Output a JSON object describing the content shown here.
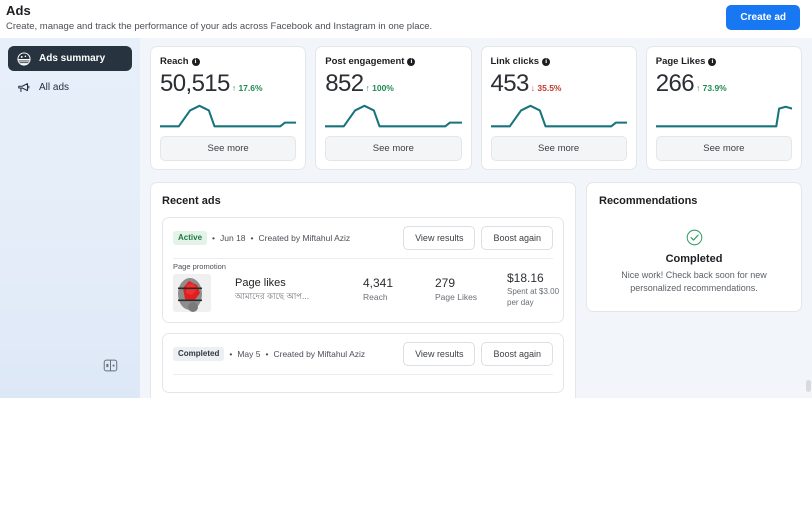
{
  "header": {
    "title": "Ads",
    "subtitle": "Create, manage and track the performance of your ads across Facebook and Instagram in one place.",
    "create_ad_label": "Create ad"
  },
  "sidebar": {
    "items": [
      {
        "label": "Ads summary",
        "icon": "ads-summary-icon",
        "active": true
      },
      {
        "label": "All ads",
        "icon": "megaphone-icon",
        "active": false
      }
    ],
    "toggle_icon": "sidebar-toggle-icon"
  },
  "stats": {
    "see_more_label": "See more",
    "cards": [
      {
        "label": "Reach",
        "value": "50,515",
        "delta": "17.6%",
        "direction": "up",
        "arrow": "↑"
      },
      {
        "label": "Post engagement",
        "value": "852",
        "delta": "100%",
        "direction": "up",
        "arrow": "↑"
      },
      {
        "label": "Link clicks",
        "value": "453",
        "delta": "35.5%",
        "direction": "down",
        "arrow": "↓"
      },
      {
        "label": "Page Likes",
        "value": "266",
        "delta": "73.9%",
        "direction": "up",
        "arrow": "↑"
      }
    ]
  },
  "recent_ads": {
    "title": "Recent ads",
    "view_results_label": "View results",
    "boost_again_label": "Boost again",
    "items": [
      {
        "status": "Active",
        "status_kind": "active",
        "sep1": "•",
        "date": "Jun 18",
        "sep2": "•",
        "creator": "Created by Miftahul Aziz",
        "thumb_caption": "Page promotion",
        "headline": "Page likes",
        "subtext": "আমাদের কাছে আপ...",
        "metrics": [
          {
            "value": "4,341",
            "label": "Reach"
          },
          {
            "value": "279",
            "label": "Page Likes"
          }
        ],
        "spend_value": "$18.16",
        "spend_label_line1": "Spent at $3.00",
        "spend_label_line2": "per day"
      },
      {
        "status": "Completed",
        "status_kind": "completed",
        "sep1": "•",
        "date": "May 5",
        "sep2": "•",
        "creator": "Created by Miftahul Aziz"
      }
    ]
  },
  "recommendations": {
    "title": "Recommendations",
    "state_icon": "check-circle-icon",
    "state_heading": "Completed",
    "state_text": "Nice work! Check back soon for new personalized recommendations."
  },
  "colors": {
    "brand_blue": "#1877f2",
    "sparkline_teal": "#18747c",
    "positive_green": "#1f8a55",
    "negative_red": "#c0392b",
    "sidebar_active": "#27333f"
  }
}
